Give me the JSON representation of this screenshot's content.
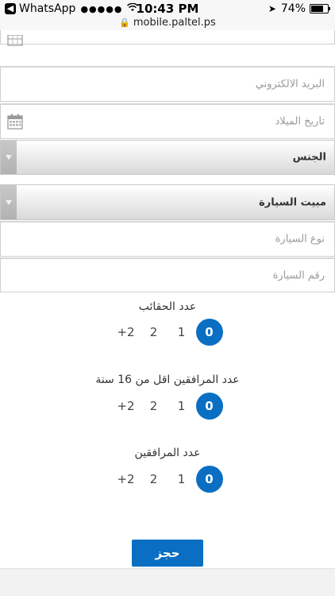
{
  "status_bar": {
    "back_app": "WhatsApp",
    "signal": "●●●●●",
    "time": "10:43 PM",
    "url": "mobile.paltel.ps",
    "battery": "74%",
    "battery_level": 0.74
  },
  "fields": {
    "partial_top": "",
    "email_placeholder": "البريد الالكتروني",
    "birthdate_placeholder": "تاريخ الميلاد",
    "car_type_placeholder": "نوع السيارة",
    "car_number_placeholder": "رقم السيارة"
  },
  "selects": {
    "gender": "الجنس",
    "car_parking": "مبيت السيارة"
  },
  "counters": [
    {
      "title": "عدد الحقائب",
      "options": [
        "0",
        "1",
        "2",
        "+2"
      ],
      "selected": "0"
    },
    {
      "title": "عدد المرافقين اقل من 16 سنة",
      "options": [
        "0",
        "1",
        "2",
        "+2"
      ],
      "selected": "0"
    },
    {
      "title": "عدد المرافقين",
      "options": [
        "0",
        "1",
        "2",
        "+2"
      ],
      "selected": "0"
    }
  ],
  "book_button": "حجز",
  "colors": {
    "accent": "#0a6fc2"
  }
}
